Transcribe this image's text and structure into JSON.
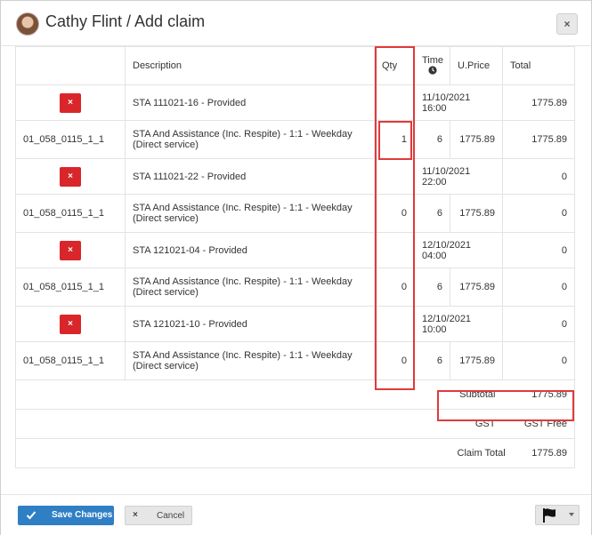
{
  "header": {
    "title": "Cathy Flint / Add claim",
    "close_label": "×"
  },
  "table": {
    "columns": {
      "description": "Description",
      "qty": "Qty",
      "time": "Time",
      "uprice": "U.Price",
      "total": "Total"
    },
    "delete_icon": "×",
    "slots": [
      {
        "label": "STA 111021-16 - Provided",
        "datetime": "11/10/2021 16:00",
        "total": "1775.89",
        "item": {
          "code": "01_058_0115_1_1",
          "description": "STA And Assistance (Inc. Respite) - 1:1 - Weekday (Direct service)",
          "qty": "1",
          "time": "6",
          "uprice": "1775.89",
          "total": "1775.89"
        }
      },
      {
        "label": "STA 111021-22 - Provided",
        "datetime": "11/10/2021 22:00",
        "total": "0",
        "item": {
          "code": "01_058_0115_1_1",
          "description": "STA And Assistance (Inc. Respite) - 1:1 - Weekday (Direct service)",
          "qty": "0",
          "time": "6",
          "uprice": "1775.89",
          "total": "0"
        }
      },
      {
        "label": "STA 121021-04 - Provided",
        "datetime": "12/10/2021 04:00",
        "total": "0",
        "item": {
          "code": "01_058_0115_1_1",
          "description": "STA And Assistance (Inc. Respite) - 1:1 - Weekday (Direct service)",
          "qty": "0",
          "time": "6",
          "uprice": "1775.89",
          "total": "0"
        }
      },
      {
        "label": "STA 121021-10 - Provided",
        "datetime": "12/10/2021 10:00",
        "total": "0",
        "item": {
          "code": "01_058_0115_1_1",
          "description": "STA And Assistance (Inc. Respite) - 1:1 - Weekday (Direct service)",
          "qty": "0",
          "time": "6",
          "uprice": "1775.89",
          "total": "0"
        }
      }
    ]
  },
  "summary": {
    "subtotal_label": "Subtotal",
    "subtotal_value": "1775.89",
    "gst_label": "GST",
    "gst_value": "GST Free",
    "claim_total_label": "Claim Total",
    "claim_total_value": "1775.89"
  },
  "footer": {
    "save_label": "Save Changes",
    "cancel_label": "Cancel"
  }
}
